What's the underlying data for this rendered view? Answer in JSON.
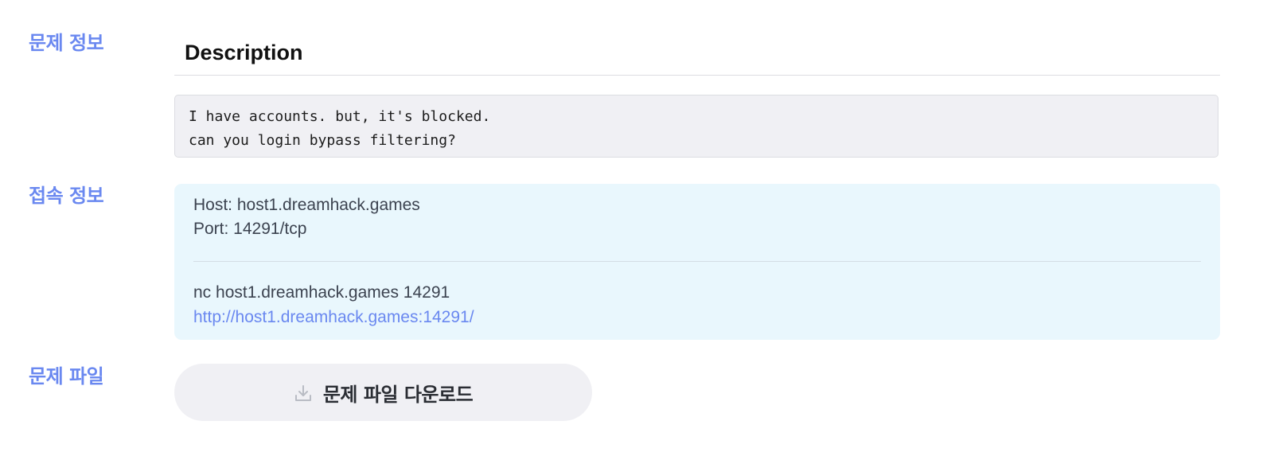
{
  "sections": {
    "problem_info_label": "문제 정보",
    "connection_info_label": "접속 정보",
    "problem_file_label": "문제 파일"
  },
  "description": {
    "heading": "Description",
    "lines": [
      "I have accounts. but, it's blocked.",
      "can you login bypass filtering?"
    ]
  },
  "connection": {
    "host": "Host: host1.dreamhack.games",
    "port": "Port: 14291/tcp",
    "nc_command": "nc host1.dreamhack.games 14291",
    "url": "http://host1.dreamhack.games:14291/"
  },
  "download": {
    "label": "문제 파일 다운로드",
    "icon": "download-icon"
  },
  "colors": {
    "accent": "#6a88f0",
    "code_bg": "#f0f0f4",
    "connection_bg": "#e9f7fd",
    "button_bg": "#f0f0f4"
  }
}
